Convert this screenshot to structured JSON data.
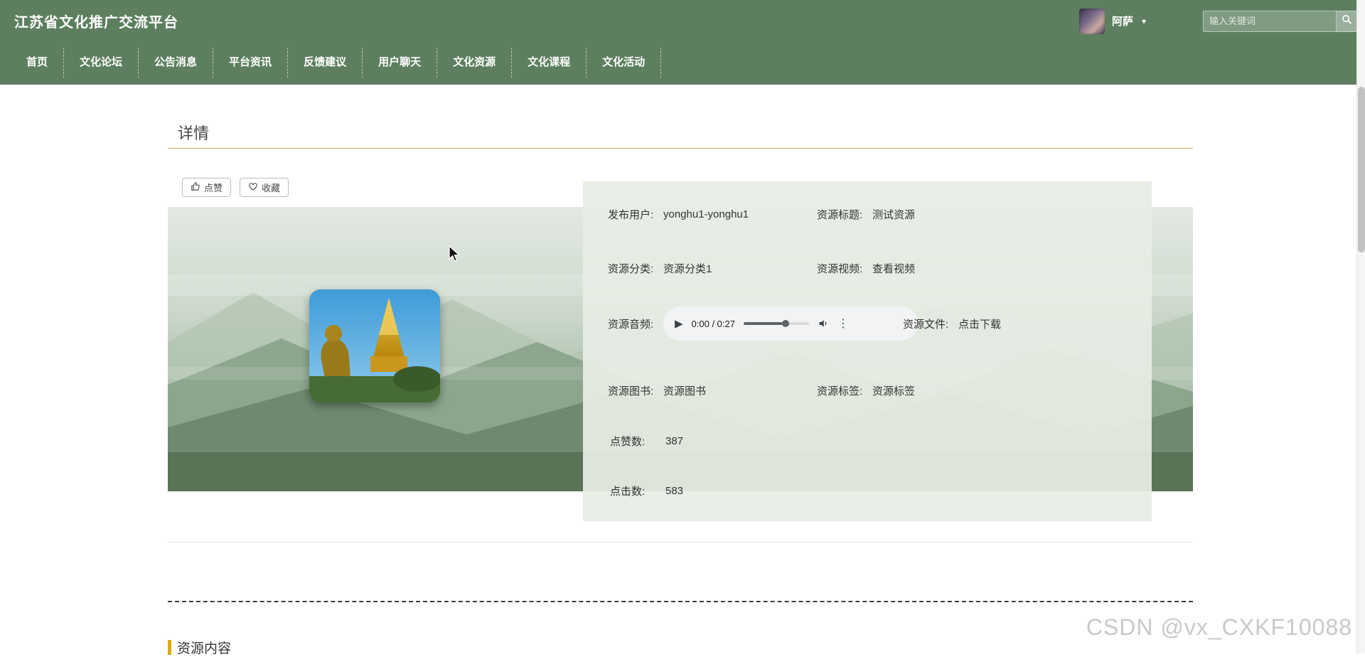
{
  "header": {
    "title": "江苏省文化推广交流平台",
    "user": {
      "name": "阿萨"
    },
    "search": {
      "placeholder": "输入关键词"
    }
  },
  "icons": {
    "caret": "▾",
    "play": "▶",
    "kebab": "⋮"
  },
  "nav": {
    "items": [
      "首页",
      "文化论坛",
      "公告消息",
      "平台资讯",
      "反馈建议",
      "用户聊天",
      "文化资源",
      "文化课程",
      "文化活动"
    ]
  },
  "page": {
    "title": "详情",
    "actions": {
      "like_label": "点赞",
      "favorite_label": "收藏"
    },
    "details": {
      "publisher_label": "发布用户:",
      "publisher_value": "yonghu1-yonghu1",
      "title_label": "资源标题:",
      "title_value": "测试资源",
      "category_label": "资源分类:",
      "category_value": "资源分类1",
      "video_label": "资源视频:",
      "video_value": "查看视频",
      "audio_label": "资源音频:",
      "file_label": "资源文件:",
      "file_value": "点击下载",
      "book_label": "资源图书:",
      "book_value": "资源图书",
      "tag_label": "资源标签:",
      "tag_value": "资源标签",
      "likes_label": "点赞数:",
      "likes_value": "387",
      "clicks_label": "点击数:",
      "clicks_value": "583"
    },
    "audio_player": {
      "time": "0:00 / 0:27"
    },
    "section_title": "资源内容"
  },
  "watermark": "CSDN @vx_CXKF10088"
}
